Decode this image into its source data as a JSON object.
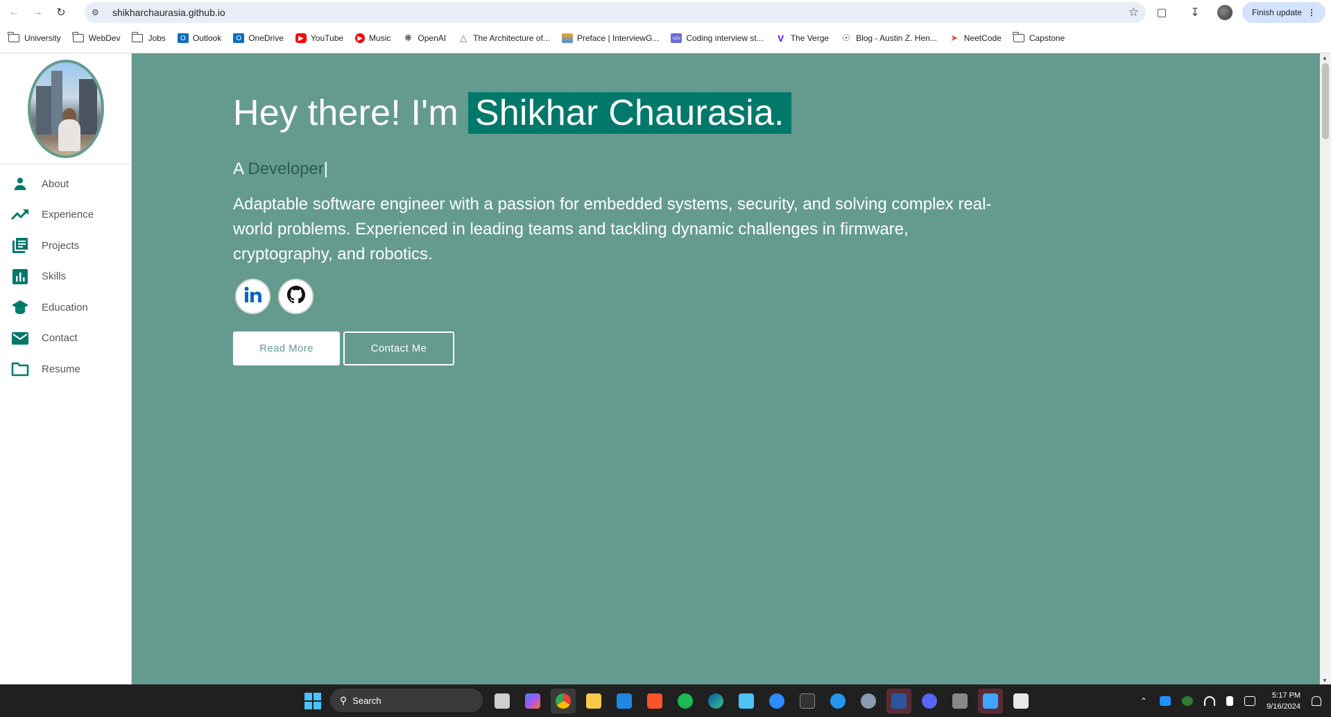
{
  "browser": {
    "url": "shikharchaurasia.github.io",
    "finish_update": "Finish update",
    "bookmarks": [
      {
        "label": "University",
        "icon": "folder-icon"
      },
      {
        "label": "WebDev",
        "icon": "folder-icon"
      },
      {
        "label": "Jobs",
        "icon": "folder-icon"
      },
      {
        "label": "Outlook",
        "icon": "outlook-icon"
      },
      {
        "label": "OneDrive",
        "icon": "outlook-icon"
      },
      {
        "label": "YouTube",
        "icon": "youtube-icon"
      },
      {
        "label": "Music",
        "icon": "music-icon"
      },
      {
        "label": "OpenAI",
        "icon": "openai-icon"
      },
      {
        "label": "The Architecture of...",
        "icon": "architecture-icon"
      },
      {
        "label": "Preface | InterviewG...",
        "icon": "book-icon"
      },
      {
        "label": "Coding interview st...",
        "icon": "code-icon"
      },
      {
        "label": "The Verge",
        "icon": "verge-icon"
      },
      {
        "label": "Blog - Austin Z. Hen...",
        "icon": "globe-icon"
      },
      {
        "label": "NeetCode",
        "icon": "rocket-icon"
      },
      {
        "label": "Capstone",
        "icon": "folder-icon"
      }
    ]
  },
  "sidebar": {
    "items": [
      {
        "label": "About",
        "icon": "person-icon"
      },
      {
        "label": "Experience",
        "icon": "trending-up-icon"
      },
      {
        "label": "Projects",
        "icon": "library-icon"
      },
      {
        "label": "Skills",
        "icon": "bar-chart-icon"
      },
      {
        "label": "Education",
        "icon": "graduation-cap-icon"
      },
      {
        "label": "Contact",
        "icon": "mail-icon"
      },
      {
        "label": "Resume",
        "icon": "folder-icon"
      }
    ]
  },
  "hero": {
    "greeting": "Hey there! I'm",
    "name": "Shikhar Chaurasia.",
    "role_prefix": "A ",
    "role": "Developer",
    "cursor": "|",
    "bio": "Adaptable software engineer with a passion for embedded systems, security, and solving complex real-world problems. Experienced in leading teams and tackling dynamic challenges in firmware, cryptography, and robotics.",
    "read_more": "Read More",
    "contact_me": "Contact Me"
  },
  "taskbar": {
    "search": "Search",
    "time": "5:17 PM",
    "date": "9/16/2024"
  },
  "colors": {
    "hero_bg": "#659b8f",
    "accent": "#00796b"
  }
}
